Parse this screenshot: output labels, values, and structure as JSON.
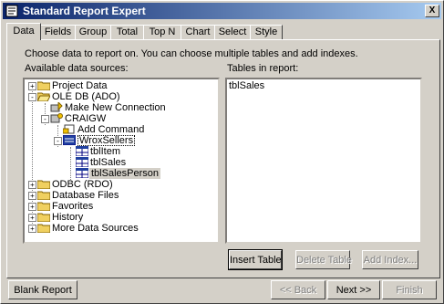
{
  "window": {
    "title": "Standard Report Expert",
    "close_label": "X"
  },
  "tabs": [
    {
      "label": "Data",
      "active": true
    },
    {
      "label": "Fields",
      "active": false
    },
    {
      "label": "Group",
      "active": false
    },
    {
      "label": "Total",
      "active": false
    },
    {
      "label": "Top N",
      "active": false
    },
    {
      "label": "Chart",
      "active": false
    },
    {
      "label": "Select",
      "active": false
    },
    {
      "label": "Style",
      "active": false
    }
  ],
  "panel": {
    "instructions": "Choose data to report on. You can choose multiple tables and add indexes.",
    "available_label": "Available data sources:",
    "tables_label": "Tables in report:"
  },
  "tree": [
    {
      "label": "Project Data",
      "icon": "folder-icon",
      "expander": "+"
    },
    {
      "label": "OLE DB (ADO)",
      "icon": "folder-open-icon",
      "expander": "-"
    },
    {
      "label": "Make New Connection",
      "icon": "connection-icon",
      "expander": ""
    },
    {
      "label": "CRAIGW",
      "icon": "server-icon",
      "expander": "-"
    },
    {
      "label": "Add Command",
      "icon": "command-icon",
      "expander": ""
    },
    {
      "label": "WroxSellers",
      "icon": "database-icon",
      "expander": "-",
      "selected": true
    },
    {
      "label": "tblItem",
      "icon": "table-icon",
      "expander": ""
    },
    {
      "label": "tblSales",
      "icon": "table-icon",
      "expander": ""
    },
    {
      "label": "tblSalesPerson",
      "icon": "table-icon",
      "expander": "",
      "highlight": true
    },
    {
      "label": "ODBC (RDO)",
      "icon": "folder-icon",
      "expander": "+"
    },
    {
      "label": "Database Files",
      "icon": "folder-icon",
      "expander": "+"
    },
    {
      "label": "Favorites",
      "icon": "folder-icon",
      "expander": "+"
    },
    {
      "label": "History",
      "icon": "folder-icon",
      "expander": "+"
    },
    {
      "label": "More Data Sources",
      "icon": "folder-icon",
      "expander": "+"
    }
  ],
  "tables_in_report": [
    "tblSales"
  ],
  "buttons": {
    "insert_table": "Insert Table",
    "delete_table": "Delete Table",
    "add_index": "Add Index...",
    "blank_report": "Blank Report",
    "back": "<< Back",
    "next": "Next >>",
    "finish": "Finish"
  }
}
